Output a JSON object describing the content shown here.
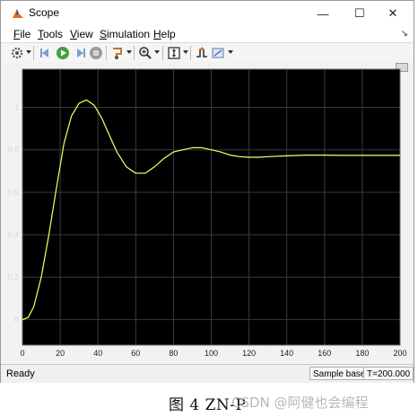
{
  "window": {
    "title": "Scope"
  },
  "title_buttons": {
    "minimize": "—",
    "maximize": "☐",
    "close": "✕"
  },
  "menu": {
    "items": [
      "File",
      "Tools",
      "View",
      "Simulation",
      "Help"
    ],
    "pin": "↘"
  },
  "status": {
    "ready": "Ready",
    "mode": "Sample based",
    "time": "T=200.000"
  },
  "caption": "图 4 ZN-P",
  "watermark": "CSDN @阿健也会编程",
  "colors": {
    "axes_background": "#000000",
    "trace": "#ffff66",
    "grid": "#3a3a3a",
    "tick_label": "#d8d8d8"
  },
  "chart_data": {
    "type": "line",
    "title": "",
    "xlabel": "",
    "ylabel": "",
    "xlim": [
      0,
      200
    ],
    "ylim": [
      -0.12,
      1.18
    ],
    "xticks": [
      0,
      20,
      40,
      60,
      80,
      100,
      120,
      140,
      160,
      180,
      200
    ],
    "yticks": [
      0,
      0.2,
      0.4,
      0.6,
      0.8,
      1
    ],
    "grid": true,
    "series": [
      {
        "x": [
          0,
          3,
          6,
          10,
          14,
          18,
          22,
          26,
          30,
          34,
          38,
          42,
          46,
          50,
          55,
          60,
          65,
          70,
          75,
          80,
          85,
          90,
          95,
          100,
          105,
          110,
          115,
          120,
          125,
          130,
          140,
          150,
          160,
          170,
          180,
          190,
          200
        ],
        "y": [
          0,
          0.01,
          0.06,
          0.2,
          0.4,
          0.62,
          0.83,
          0.96,
          1.02,
          1.035,
          1.01,
          0.95,
          0.87,
          0.79,
          0.72,
          0.69,
          0.69,
          0.72,
          0.76,
          0.79,
          0.8,
          0.81,
          0.81,
          0.8,
          0.79,
          0.775,
          0.768,
          0.765,
          0.765,
          0.768,
          0.772,
          0.775,
          0.775,
          0.774,
          0.774,
          0.774,
          0.774
        ]
      }
    ]
  }
}
